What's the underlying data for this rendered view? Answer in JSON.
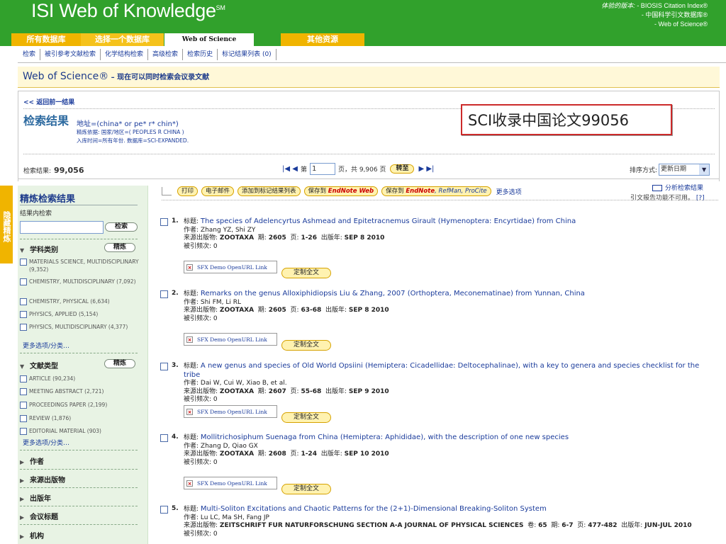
{
  "header": {
    "logo": "ISI Web of Knowledge",
    "logo_mark": "SM",
    "sub_label": "体验的版本:",
    "subs": [
      "- BIOSIS Citation Index®",
      "- 中国科学引文数据库®",
      "- Web of Science®"
    ]
  },
  "db_tabs": [
    "所有数据库",
    "选择一个数据库",
    "Web of Science",
    "其他资源"
  ],
  "subnav": [
    "检索",
    "被引参考文献检索",
    "化学结构检索",
    "高级检索",
    "检索历史",
    "标记结果列表 (0)"
  ],
  "wos": {
    "title": "Web of Science®",
    "subtitle": " – 现在可以同时检索会议录文献"
  },
  "results_header": {
    "back": "<< 返回前一结果",
    "title": "检索结果",
    "query": "地址=(china* or pe* r* chin*)",
    "refine": "精炼依据: 国家/地区=( PEOPLES R CHINA )",
    "timespan": "入库时间=所有年份. 数据库=SCI-EXPANDED.",
    "overlay": "SCI收录中国论文99056",
    "count_label": "检索结果:",
    "count": "99,056",
    "page_prefix": "第",
    "page_value": "1",
    "page_suffix": "页，共 9,906 页",
    "goto": "转至",
    "sort_label": "排序方式:",
    "sort_value": "更新日期"
  },
  "side_tab": "隐藏精炼",
  "refine_panel": {
    "title": "精炼检索结果",
    "within": "结果内检索",
    "search_btn": "检索",
    "subject_title": "学科类别",
    "refine_btn": "精炼",
    "subjects": [
      "MATERIALS SCIENCE, MULTIDISCIPLINARY (9,352)",
      "CHEMISTRY, MULTIDISCIPLINARY (7,092)",
      "CHEMISTRY, PHYSICAL (6,634)",
      "PHYSICS, APPLIED (5,154)",
      "PHYSICS, MULTIDISCIPLINARY (4,377)"
    ],
    "more": "更多选项/分类…",
    "doctype_title": "文献类型",
    "doctypes": [
      "ARTICLE (90,234)",
      "MEETING ABSTRACT (2,721)",
      "PROCEEDINGS PAPER (2,199)",
      "REVIEW (1,876)",
      "EDITORIAL MATERIAL (903)"
    ],
    "collapsed": [
      "作者",
      "来源出版物",
      "出版年",
      "会议标题",
      "机构"
    ]
  },
  "toolbar": {
    "print": "打印",
    "email": "电子邮件",
    "mark": "添加到标记结果列表",
    "save_endnote": "保存到",
    "endnote_web": "EndNote Web",
    "save_to": "保存到",
    "endnote": "EndNote",
    "refman": ", RefMan, ProCite",
    "more": "更多选项",
    "analyze": "分析检索结果",
    "citation_msg": "引文报告功能不可用。",
    "help": "[?]"
  },
  "record_labels": {
    "title": "标题:",
    "author": "作者:",
    "source": "来源出版物:",
    "volume": "卷:",
    "issue": "期:",
    "pages": "页:",
    "pubdate": "出版年:",
    "cited": "被引频次:",
    "sfx": "SFX Demo OpenURL Link",
    "fulltext": "定制全文"
  },
  "records": [
    {
      "num": "1.",
      "title": "The species of Adelencyrtus Ashmead and Epitetracnemus Girault (Hymenoptera: Encyrtidae) from China",
      "authors": "Zhang YZ, Shi ZY",
      "source": "ZOOTAXA",
      "issue": "2605",
      "pages": "1-26",
      "pubdate": "SEP 8 2010",
      "cited": "0"
    },
    {
      "num": "2.",
      "title": "Remarks on the genus Alloxiphidiopsis Liu & Zhang, 2007 (Orthoptera, Meconematinae) from Yunnan, China",
      "authors": "Shi FM, Li RL",
      "source": "ZOOTAXA",
      "issue": "2605",
      "pages": "63-68",
      "pubdate": "SEP 8 2010",
      "cited": "0"
    },
    {
      "num": "3.",
      "title": "A new genus and species of Old World Opsiini (Hemiptera: Cicadellidae: Deltocephalinae), with a key to genera and species checklist for the tribe",
      "authors": "Dai W, Cui W, Xiao B, et al.",
      "source": "ZOOTAXA",
      "issue": "2607",
      "pages": "55-68",
      "pubdate": "SEP 9 2010",
      "cited": "0"
    },
    {
      "num": "4.",
      "title": "Mollitrichosiphum Suenaga from China (Hemiptera: Aphididae), with the description of one new species",
      "authors": "Zhang D, Qiao GX",
      "source": "ZOOTAXA",
      "issue": "2608",
      "pages": "1-24",
      "pubdate": "SEP 10 2010",
      "cited": "0"
    },
    {
      "num": "5.",
      "title": "Multi-Soliton Excitations and Chaotic Patterns for the (2+1)-Dimensional Breaking-Soliton System",
      "authors": "Lu LC, Ma SH, Fang JP",
      "source": "ZEITSCHRIFT FUR NATURFORSCHUNG SECTION A-A JOURNAL OF PHYSICAL SCIENCES",
      "volume": "65",
      "issue": "6-7",
      "pages": "477-482",
      "pubdate": "JUN-JUL 2010",
      "cited": "0"
    }
  ]
}
